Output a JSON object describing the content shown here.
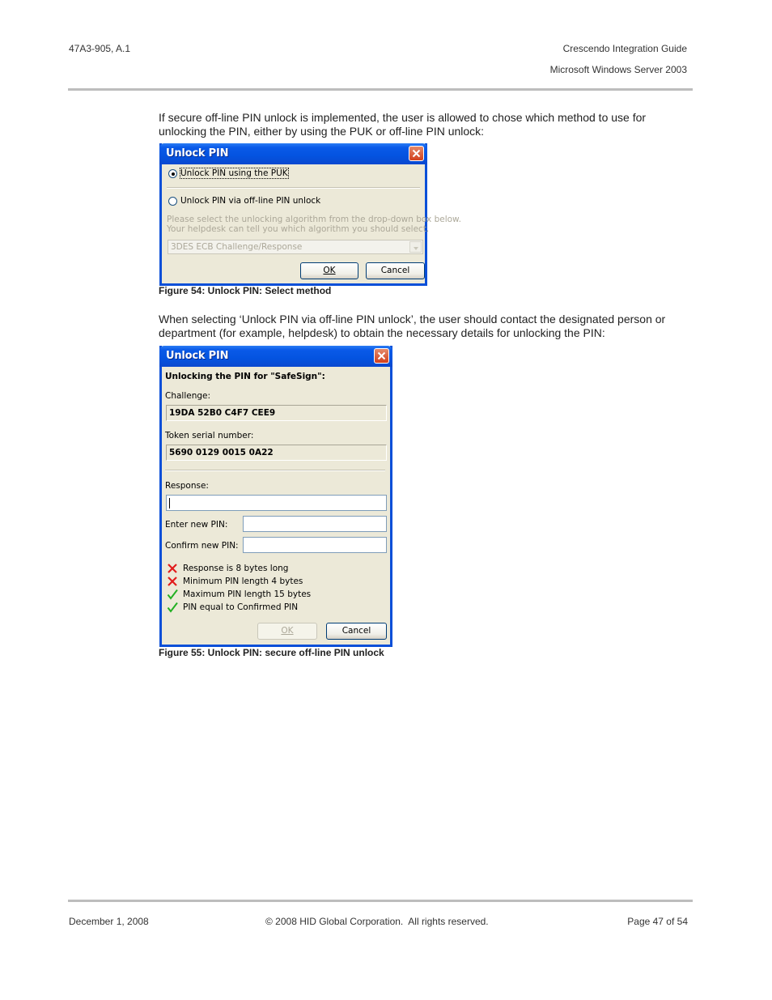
{
  "header": {
    "doc_id": "47A3-905, A.1",
    "title": "Crescendo Integration Guide",
    "subtitle": "Microsoft Windows Server 2003"
  },
  "intro_paragraph": "If secure off-line PIN unlock is implemented, the user is allowed to chose which method to use for unlocking the PIN, either by using the PUK or off-line PIN unlock:",
  "figure54": {
    "dialog": {
      "title": "Unlock PIN",
      "radio_options": [
        {
          "label": "Unlock PIN using the PUK",
          "checked": true
        },
        {
          "label": "Unlock PIN via off-line PIN unlock",
          "checked": false
        }
      ],
      "instructions_line1": "Please select the unlocking algorithm from the drop-down box below.",
      "instructions_line2": "Your helpdesk can tell you which algorithm you should select.",
      "algorithm_select": {
        "value": "3DES ECB Challenge/Response",
        "disabled": true
      },
      "ok_label": "OK",
      "cancel_label": "Cancel"
    },
    "caption": "Figure 54: Unlock PIN: Select method"
  },
  "second_paragraph": "When selecting ‘Unlock PIN via off-line PIN unlock’, the user should contact the designated person or department (for example, helpdesk) to obtain the necessary details for unlocking the PIN:",
  "figure55": {
    "dialog": {
      "title": "Unlock PIN",
      "heading": "Unlocking the PIN for \"SafeSign\":",
      "challenge_label": "Challenge:",
      "challenge_value": "19DA 52B0 C4F7 CEE9",
      "serial_label": "Token serial number:",
      "serial_value": "5690 0129 0015 0A22",
      "response_label": "Response:",
      "response_value": "",
      "new_pin_label": "Enter new PIN:",
      "new_pin_value": "",
      "confirm_pin_label": "Confirm new PIN:",
      "confirm_pin_value": "",
      "checks": [
        {
          "label": "Response is 8 bytes long",
          "status": "fail"
        },
        {
          "label": "Minimum PIN length 4 bytes",
          "status": "fail"
        },
        {
          "label": "Maximum PIN length 15 bytes",
          "status": "pass"
        },
        {
          "label": "PIN equal to Confirmed PIN",
          "status": "pass"
        }
      ],
      "ok_label": "OK",
      "ok_disabled": true,
      "cancel_label": "Cancel"
    },
    "caption": "Figure 55: Unlock PIN: secure off-line PIN unlock"
  },
  "footer": {
    "date": "December 1, 2008",
    "copyright": "© 2008 HID Global Corporation.  All rights reserved.",
    "page": "Page 47 of 54"
  },
  "colors": {
    "fail": "#e11b1b",
    "pass": "#22b022",
    "titlebar": "#0453e0"
  }
}
